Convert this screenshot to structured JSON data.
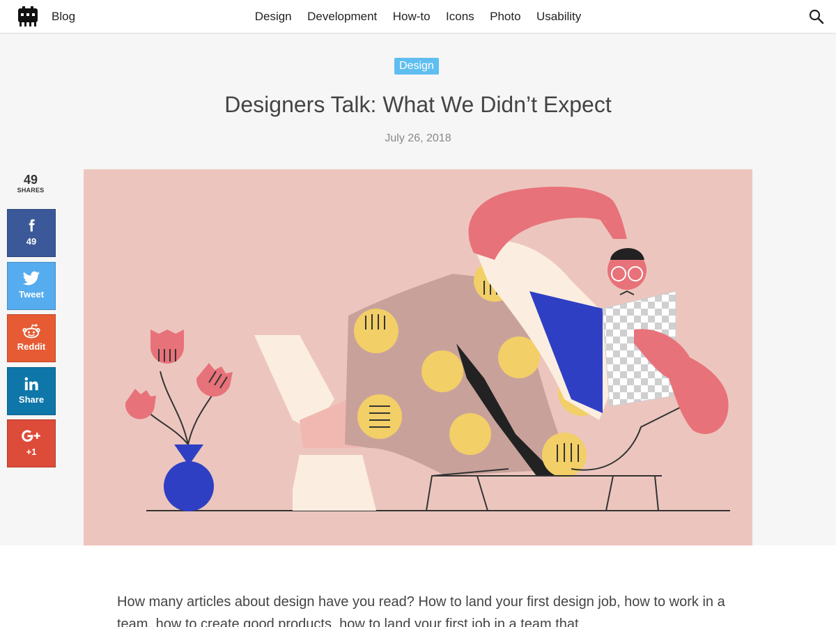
{
  "header": {
    "blog_label": "Blog",
    "nav": [
      "Design",
      "Development",
      "How-to",
      "Icons",
      "Photo",
      "Usability"
    ],
    "logo_icon": "site-logo-icon",
    "search_icon": "search-icon"
  },
  "article": {
    "category": "Design",
    "title": "Designers Talk: What We Didn’t Expect",
    "date": "July 26, 2018",
    "intro": "How many articles about design have you read? How to land your first design job, how to work in a team, how to create good products, how to land your first job in a team that"
  },
  "share": {
    "total": "49",
    "total_label": "SHARES",
    "buttons": [
      {
        "network": "facebook",
        "icon": "facebook-icon",
        "label": "49",
        "color": "#3b5998"
      },
      {
        "network": "twitter",
        "icon": "twitter-icon",
        "label": "Tweet",
        "color": "#55acee"
      },
      {
        "network": "reddit",
        "icon": "reddit-icon",
        "label": "Reddit",
        "color": "#e65b34"
      },
      {
        "network": "linkedin",
        "icon": "linkedin-icon",
        "label": "Share",
        "color": "#0e76a8"
      },
      {
        "network": "googleplus",
        "icon": "google-plus-icon",
        "label": "+1",
        "color": "#dd4b39"
      }
    ]
  },
  "colors": {
    "tag_bg": "#5fbef0",
    "hero_bg": "#ecc6be",
    "accent_pink": "#e8727a",
    "accent_yellow": "#f2cf67",
    "accent_blue": "#2f3fc4"
  }
}
